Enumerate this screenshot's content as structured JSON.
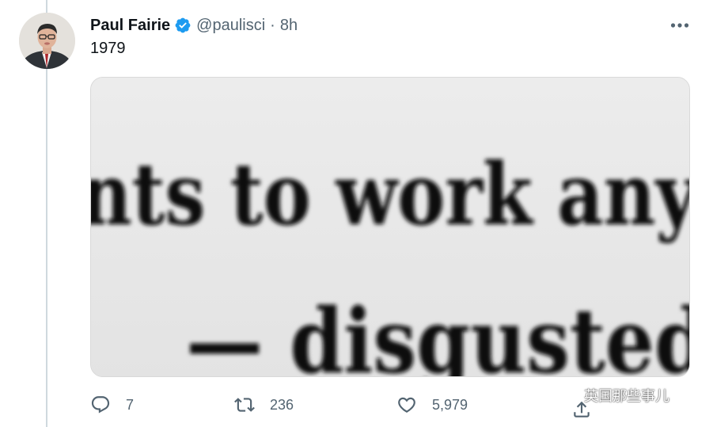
{
  "tweet": {
    "author_name": "Paul Fairie",
    "handle": "@paulisci",
    "separator": "·",
    "time": "8h",
    "text": "1979",
    "verified": true,
    "media": {
      "line1": "nts to work any",
      "line2": "— disgusted"
    }
  },
  "actions": {
    "reply_count": "7",
    "retweet_count": "236",
    "like_count": "5,979"
  },
  "watermark": {
    "text": "英国那些事儿"
  },
  "colors": {
    "verified_blue": "#1d9bf0",
    "secondary_text": "#536471",
    "thread_line": "#cfd9de"
  }
}
